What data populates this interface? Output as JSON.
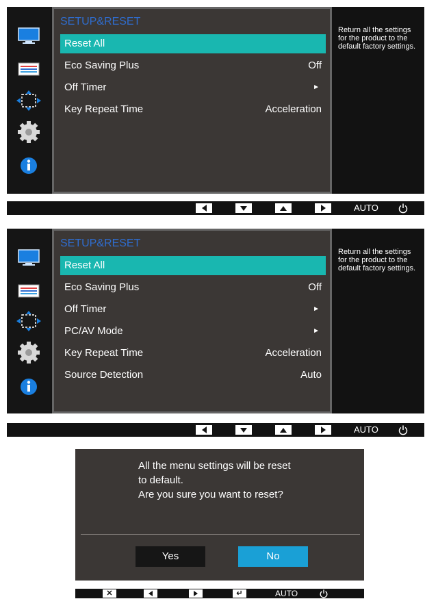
{
  "menu1": {
    "title": "SETUP&RESET",
    "items": [
      {
        "label": "Reset All",
        "value": "",
        "selected": true
      },
      {
        "label": "Eco Saving Plus",
        "value": "Off"
      },
      {
        "label": "Off Timer",
        "value": "►"
      },
      {
        "label": "Key Repeat Time",
        "value": "Acceleration"
      }
    ],
    "help": "Return all the settings for the product to the default factory settings."
  },
  "menu2": {
    "title": "SETUP&RESET",
    "items": [
      {
        "label": "Reset All",
        "value": "",
        "selected": true
      },
      {
        "label": "Eco Saving Plus",
        "value": "Off"
      },
      {
        "label": "Off Timer",
        "value": "►"
      },
      {
        "label": "PC/AV Mode",
        "value": "►"
      },
      {
        "label": "Key Repeat Time",
        "value": "Acceleration"
      },
      {
        "label": "Source Detection",
        "value": "Auto"
      }
    ],
    "help": "Return all the settings for the product to the default factory settings."
  },
  "sidebar_icons": [
    "picture-icon",
    "onscreen-display-icon",
    "position-icon",
    "gear-icon",
    "info-icon"
  ],
  "control_bar": {
    "auto_label": "AUTO",
    "icons": [
      "left-arrow-icon",
      "down-arrow-icon",
      "up-arrow-icon",
      "right-arrow-icon",
      "power-icon"
    ]
  },
  "dialog": {
    "message_lines": [
      "All the menu settings will be reset",
      "to default.",
      "Are you sure you want to reset?"
    ],
    "yes_label": "Yes",
    "no_label": "No"
  },
  "dialog_bar": {
    "auto_label": "AUTO",
    "icons": [
      "close-icon",
      "left-arrow-icon",
      "right-arrow-icon",
      "enter-icon",
      "power-icon"
    ]
  },
  "colors": {
    "selection": "#19b7b0",
    "title": "#2f6dcf",
    "no_button": "#1aa0d6",
    "menu_bg": "#3b3735"
  }
}
